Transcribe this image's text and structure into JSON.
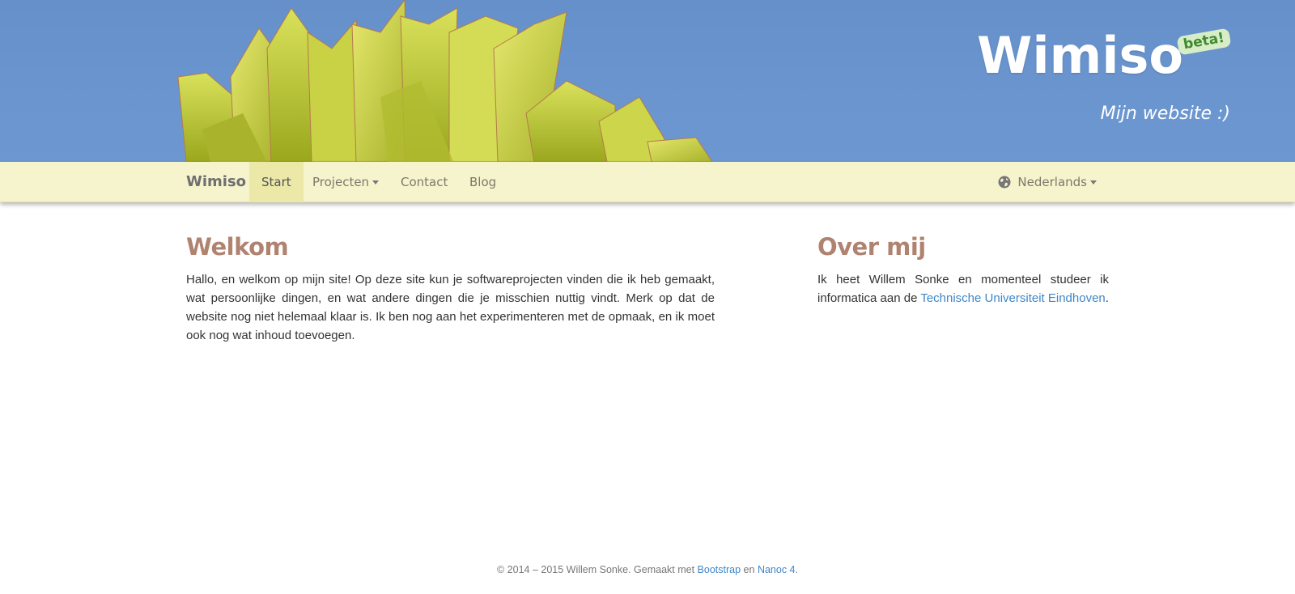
{
  "header": {
    "title": "Wimiso",
    "badge": "beta!",
    "tagline": "Mijn website :)"
  },
  "navbar": {
    "brand": "Wimiso",
    "items": [
      {
        "label": "Start",
        "active": true
      },
      {
        "label": "Projecten",
        "dropdown": true
      },
      {
        "label": "Contact"
      },
      {
        "label": "Blog"
      }
    ],
    "language": {
      "label": "Nederlands",
      "icon": "globe-icon"
    }
  },
  "main": {
    "welcome": {
      "heading": "Welkom",
      "text": "Hallo, en welkom op mijn site! Op deze site kun je softwareprojecten vinden die ik heb gemaakt, wat persoonlijke dingen, en wat andere dingen die je misschien nuttig vindt. Merk op dat de website nog niet helemaal klaar is. Ik ben nog aan het experimenteren met de opmaak, en ik moet ook nog wat inhoud toevoegen."
    },
    "about": {
      "heading": "Over mij",
      "text_before": "Ik heet Willem Sonke en momenteel studeer ik informatica aan de",
      "link": "Technische Universiteit Eindhoven",
      "text_after": "."
    }
  },
  "footer": {
    "copyright": "© 2014 – 2015  Willem Sonke. Gemaakt met",
    "link1": "Bootstrap",
    "between": "en",
    "link2": "Nanoc 4",
    "end": "."
  },
  "colors": {
    "sky": "#6a95cf",
    "navbar": "#f6f4cd",
    "nav_active": "#ebe8a8",
    "heading": "#b08370",
    "link": "#3d86c8"
  }
}
